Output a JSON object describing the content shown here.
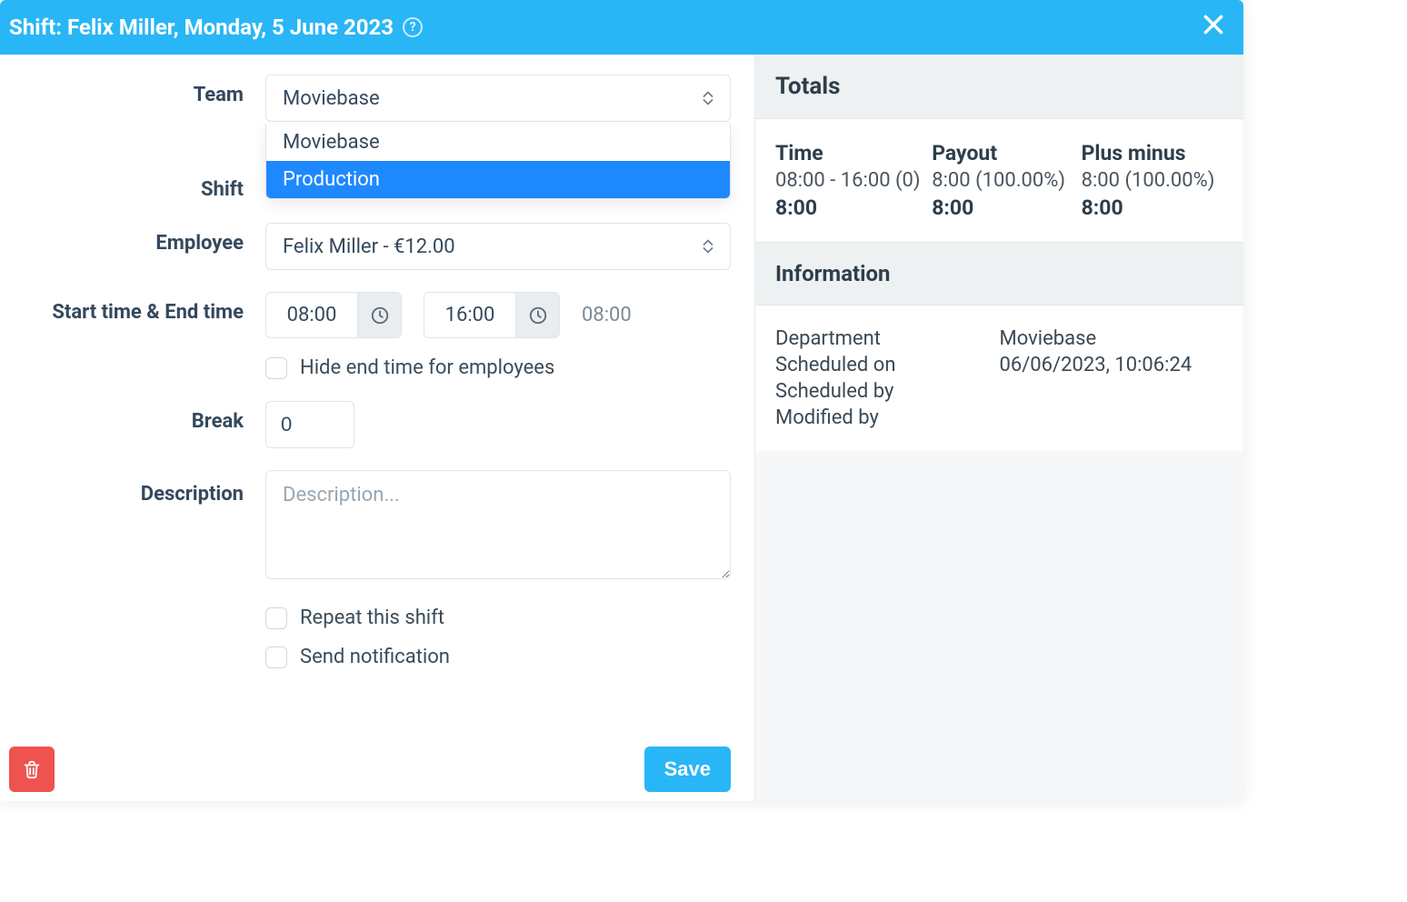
{
  "header": {
    "title": "Shift: Felix Miller, Monday, 5 June 2023"
  },
  "form": {
    "team_label": "Team",
    "team_value": "Moviebase",
    "team_options": [
      "Moviebase",
      "Production"
    ],
    "team_active_option_index": 1,
    "shift_label": "Shift",
    "employee_label": "Employee",
    "employee_value": "Felix Miller - €12.00",
    "time_label": "Start time & End time",
    "start_time": "08:00",
    "end_time": "16:00",
    "duration": "08:00",
    "hide_end_label": "Hide end time for employees",
    "break_label": "Break",
    "break_value": "0",
    "description_label": "Description",
    "description_placeholder": "Description...",
    "repeat_label": "Repeat this shift",
    "notify_label": "Send notification",
    "save_label": "Save"
  },
  "sidebar": {
    "totals_title": "Totals",
    "time_head": "Time",
    "time_sub": "08:00 - 16:00 (0)",
    "time_bold": "8:00",
    "payout_head": "Payout",
    "payout_sub": "8:00 (100.00%)",
    "payout_bold": "8:00",
    "plusminus_head": "Plus minus",
    "plusminus_sub": "8:00 (100.00%)",
    "plusminus_bold": "8:00",
    "info_title": "Information",
    "dept_label": "Department",
    "dept_value": "Moviebase",
    "sched_on_label": "Scheduled on",
    "sched_on_value": "06/06/2023, 10:06:24",
    "sched_by_label": "Scheduled by",
    "mod_by_label": "Modified by"
  }
}
